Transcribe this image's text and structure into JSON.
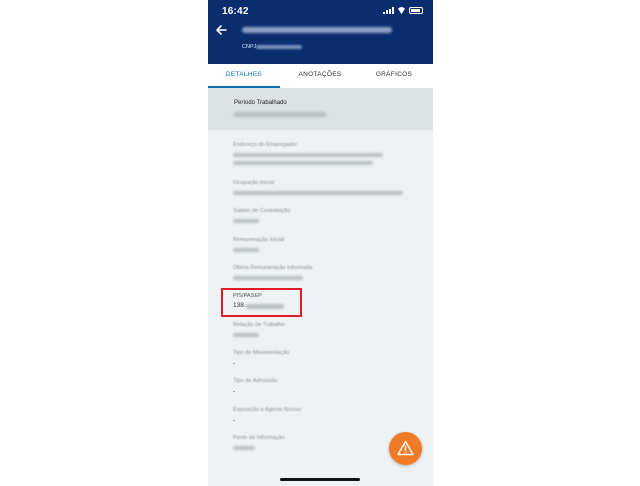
{
  "status_bar": {
    "time": "16:42"
  },
  "header": {
    "cnpj_label": "CNPJ"
  },
  "tabs": [
    {
      "label": "DETALHES",
      "active": true
    },
    {
      "label": "ANOTAÇÕES",
      "active": false
    },
    {
      "label": "GRÁFICOS",
      "active": false
    }
  ],
  "section": {
    "periodo_label": "Período Trabalhado"
  },
  "fields": {
    "endereco": {
      "label": "Endereço do Empregador"
    },
    "ocupacao": {
      "label": "Ocupação Inicial"
    },
    "salario": {
      "label": "Salário de Contratação"
    },
    "remuneracao_inicial": {
      "label": "Remuneração Inicial"
    },
    "ultima_remuneracao": {
      "label": "Última Remuneração Informada"
    },
    "pis": {
      "label": "PIS/PASEP",
      "value": "138."
    },
    "relacao": {
      "label": "Relação de Trabalho"
    },
    "movimentacao": {
      "label": "Tipo de Movimentação",
      "value": "-"
    },
    "admissao": {
      "label": "Tipo de Admissão",
      "value": "-"
    },
    "exposicao": {
      "label": "Exposição a Agente Nocivo",
      "value": "-"
    },
    "fonte": {
      "label": "Fonte da Informação"
    }
  },
  "colors": {
    "header": "#0a2d6e",
    "accent": "#0a6fb3",
    "fab": "#f07a26",
    "highlight": "#e11b22"
  },
  "icons": {
    "back": "arrow-left-icon",
    "fab": "warning-icon"
  }
}
